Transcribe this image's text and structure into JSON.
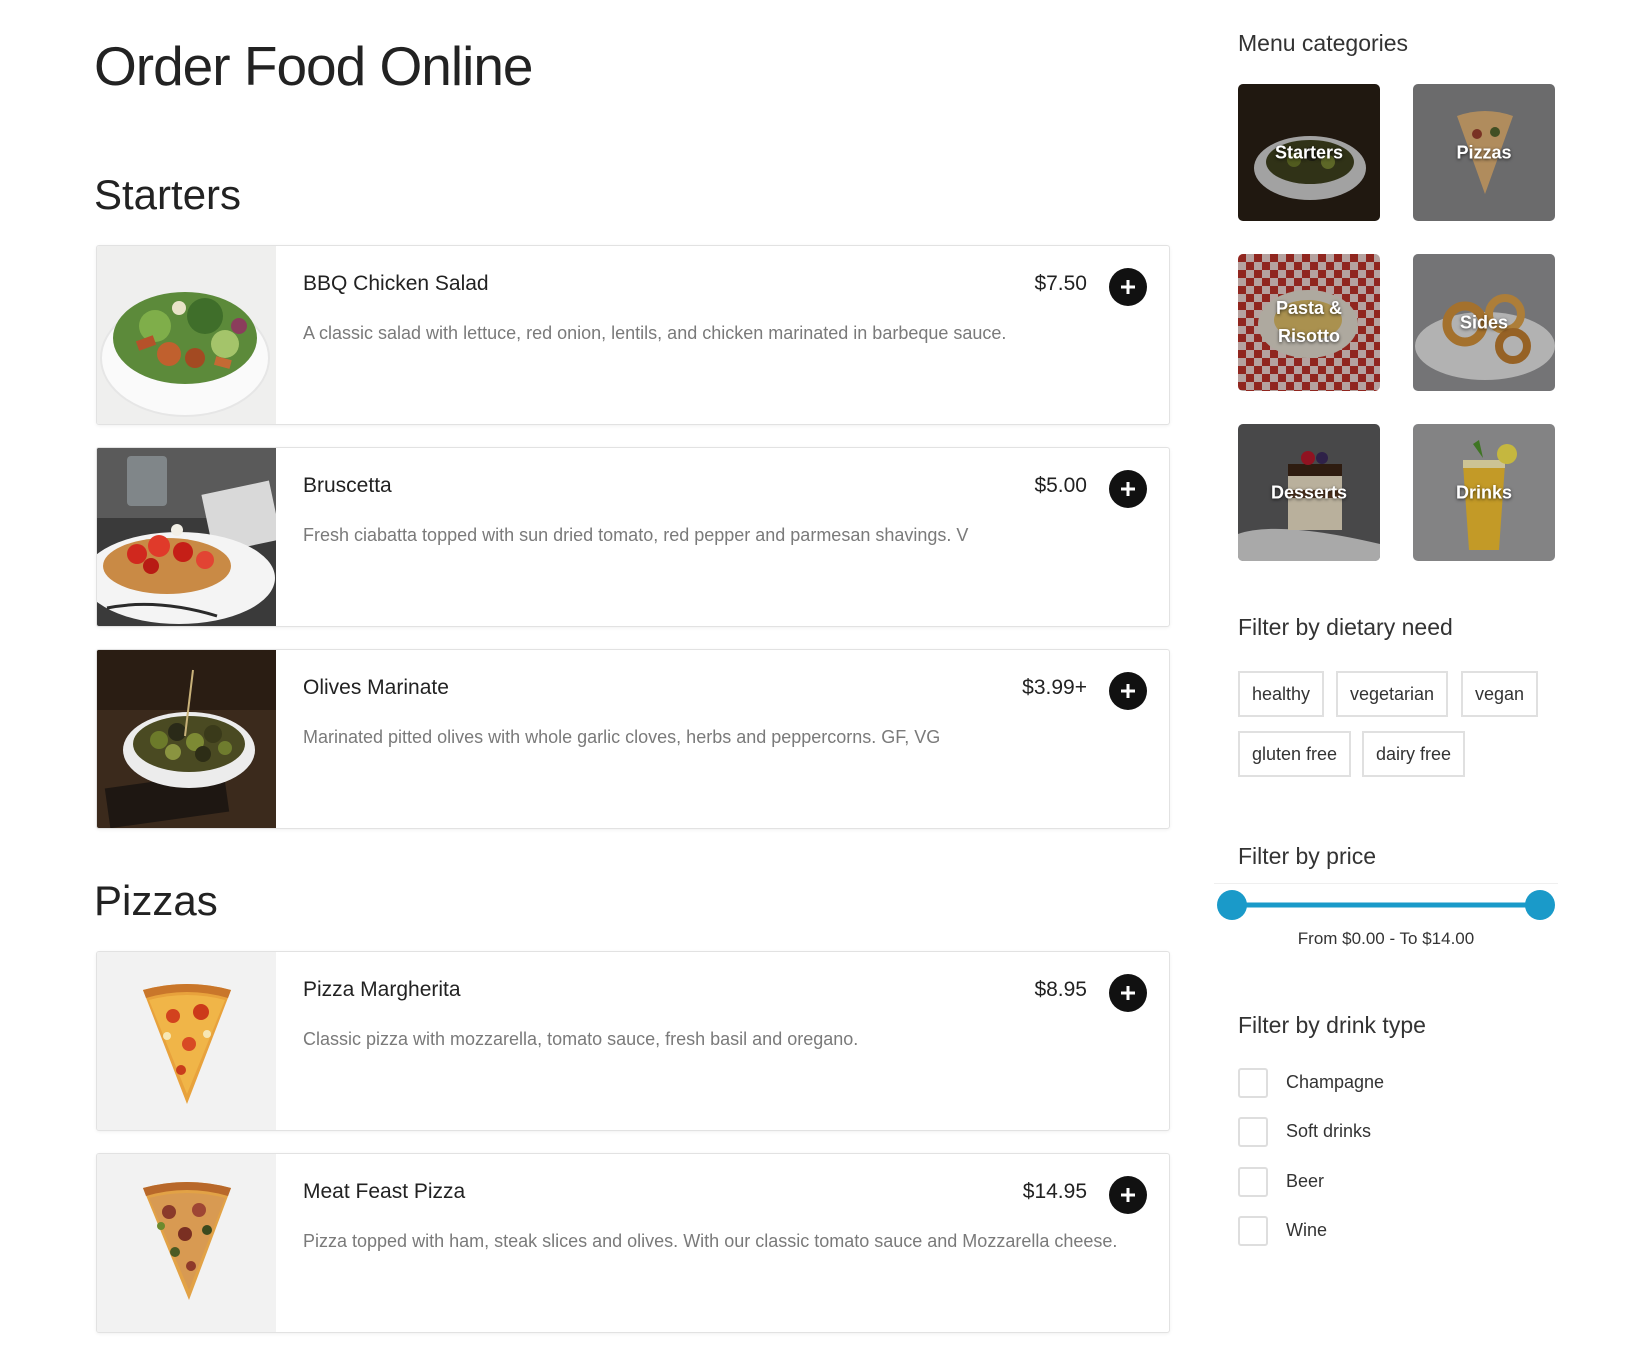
{
  "page": {
    "title": "Order Food Online"
  },
  "sections": [
    {
      "title": "Starters",
      "items": [
        {
          "name": "BBQ Chicken Salad",
          "price": "$7.50",
          "description": "A classic salad with lettuce, red onion, lentils, and chicken marinated in barbeque sauce."
        },
        {
          "name": "Bruscetta",
          "price": "$5.00",
          "description": "Fresh ciabatta topped with sun dried tomato, red pepper and parmesan shavings. V"
        },
        {
          "name": "Olives Marinate",
          "price": "$3.99+",
          "description": "Marinated pitted olives with whole garlic cloves, herbs and peppercorns. GF, VG"
        }
      ]
    },
    {
      "title": "Pizzas",
      "items": [
        {
          "name": "Pizza Margherita",
          "price": "$8.95",
          "description": "Classic pizza with mozzarella, tomato sauce, fresh basil and oregano."
        },
        {
          "name": "Meat Feast Pizza",
          "price": "$14.95",
          "description": "Pizza topped with ham, steak slices and olives. With our classic tomato sauce and Mozzarella cheese."
        }
      ]
    }
  ],
  "sidebar": {
    "categories_title": "Menu categories",
    "categories": [
      {
        "label": "Starters"
      },
      {
        "label": "Pizzas"
      },
      {
        "label": "Pasta &\nRisotto"
      },
      {
        "label": "Sides"
      },
      {
        "label": "Desserts"
      },
      {
        "label": "Drinks"
      }
    ],
    "dietary_title": "Filter by dietary need",
    "dietary_tags": [
      "healthy",
      "vegetarian",
      "vegan",
      "gluten free",
      "dairy free"
    ],
    "price_title": "Filter by price",
    "price_min": 0,
    "price_max": 14,
    "price_range_text": "From $0.00 - To $14.00",
    "drink_title": "Filter by drink type",
    "drink_types": [
      "Champagne",
      "Soft drinks",
      "Beer",
      "Wine"
    ]
  },
  "colors": {
    "slider_accent": "#1a9ac9",
    "add_button": "#111111",
    "description_text": "#7a7a7a"
  },
  "icons": {
    "add": "plus-icon",
    "checkbox": "checkbox-icon"
  }
}
